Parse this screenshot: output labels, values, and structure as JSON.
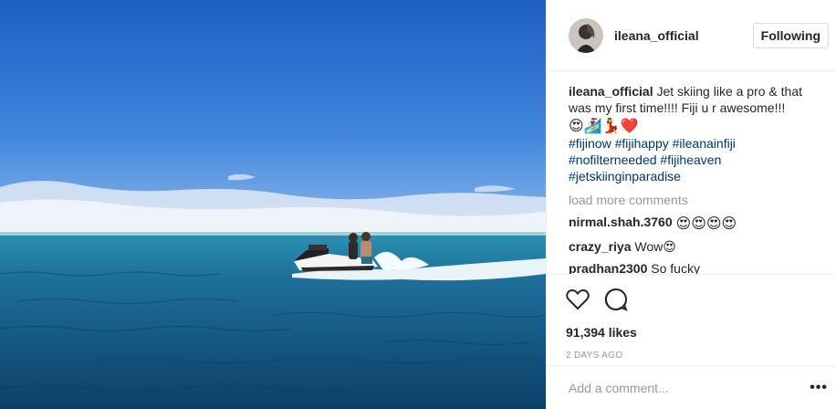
{
  "post": {
    "photo_alt": "Jet ski on the ocean"
  },
  "header": {
    "username": "ileana_official",
    "follow_label": "Following"
  },
  "caption": {
    "username": "ileana_official",
    "text": "Jet skiing like a pro & that was my first time!!!! Fiji u r awesome!!!",
    "emojis": "😍🏄‍♀️💃❤️",
    "hashtags": [
      "#fijinow",
      "#fijihappy",
      "#ileanainfiji",
      "#nofilterneeded",
      "#fijiheaven",
      "#jetskiinginparadise"
    ]
  },
  "load_more": "load more comments",
  "comments": [
    {
      "username": "nirmal.shah.3760",
      "text": "😍😍😍😍"
    },
    {
      "username": "crazy_riya",
      "text": "Wow😍"
    },
    {
      "username": "pradhan2300",
      "text": "So fucky"
    }
  ],
  "likes": "91,394 likes",
  "date": "2 DAYS AGO",
  "add_comment": {
    "placeholder": "Add a comment..."
  },
  "more_label": "•••",
  "icons": {
    "like": "heart-icon",
    "comment": "speech-bubble-icon"
  }
}
